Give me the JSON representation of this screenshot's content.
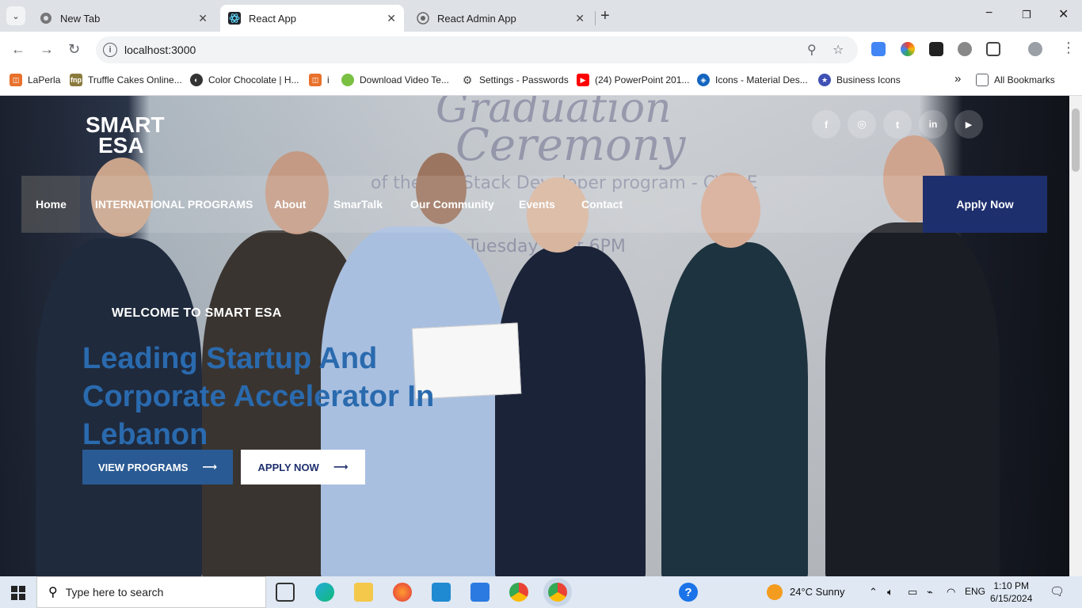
{
  "browser": {
    "tabs": [
      {
        "title": "New Tab"
      },
      {
        "title": "React App"
      },
      {
        "title": "React Admin App"
      }
    ],
    "new_tab_label": "+",
    "window_controls": {
      "minimize": "−",
      "restore": "❐",
      "close": "✕"
    },
    "url": "localhost:3000",
    "bookmarks": [
      {
        "label": "LaPerla",
        "color": "#e8712c"
      },
      {
        "label": "Truffle Cakes Online...",
        "color": "#8a7a3c"
      },
      {
        "label": "Color Chocolate | H...",
        "color": "#333333"
      },
      {
        "label": "i",
        "color": "#e8712c"
      },
      {
        "label": "Download Video Te...",
        "color": "#7ac043"
      },
      {
        "label": "Settings - Passwords",
        "color": "#444444"
      },
      {
        "label": "(24) PowerPoint 201...",
        "color": "#ff0000"
      },
      {
        "label": "Icons - Material Des...",
        "color": "#1565c0"
      },
      {
        "label": "Business Icons",
        "color": "#3f51b5"
      }
    ],
    "more_bookmarks": "»",
    "all_bookmarks": "All Bookmarks"
  },
  "site": {
    "logo_line1": "SMART",
    "logo_line2": "ESA",
    "social": [
      {
        "label": "f",
        "icon": "facebook-icon"
      },
      {
        "label": "◎",
        "icon": "instagram-icon"
      },
      {
        "label": "t",
        "icon": "twitter-icon"
      },
      {
        "label": "in",
        "icon": "linkedin-icon"
      },
      {
        "label": "▶",
        "icon": "youtube-icon"
      }
    ],
    "nav": [
      "Home",
      "INTERNATIONAL PROGRAMS",
      "About",
      "SmarTalk",
      "Our Community",
      "Events",
      "Contact"
    ],
    "apply_top": "Apply Now",
    "welcome": "WELCOME TO SMART ESA",
    "headline": "Leading Startup And Corporate Accelerator In Lebanon",
    "btn_view": "VIEW PROGRAMS",
    "btn_apply": "APPLY NOW",
    "arrow": "⟶",
    "screen_text_1": "Graduation",
    "screen_text_2": "Ceremony",
    "screen_text_3": "of the Full Stack Developer program - CYCLE",
    "screen_text_4": "Tuesday ... at 6PM"
  },
  "taskbar": {
    "search_placeholder": "Type here to search",
    "weather": "24°C  Sunny",
    "lang": "ENG",
    "time": "1:10 PM",
    "date": "6/15/2024"
  }
}
